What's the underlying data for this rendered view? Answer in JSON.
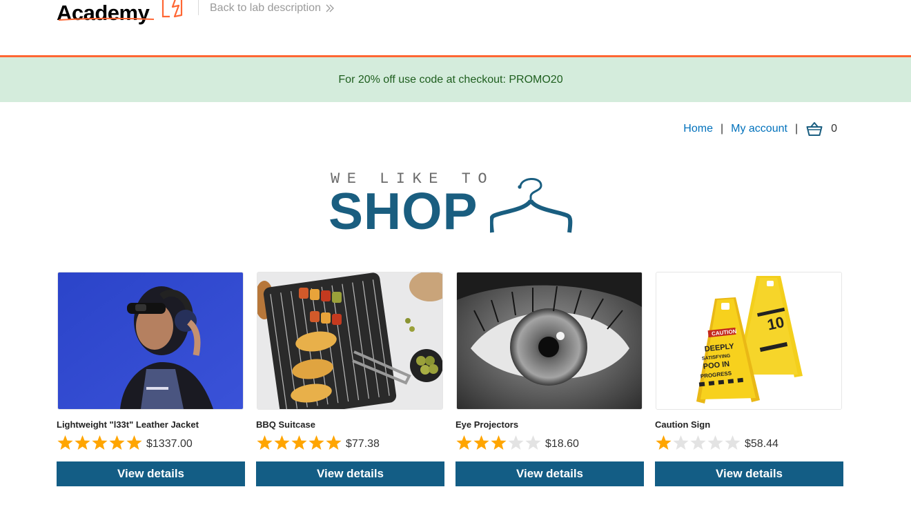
{
  "header": {
    "logo_text": "Academy",
    "back_link_label": "Back to lab description"
  },
  "promo": {
    "text": "For 20% off use code at checkout: PROMO20"
  },
  "nav": {
    "home_label": "Home",
    "separator": "|",
    "account_label": "My account",
    "cart_count": "0"
  },
  "banner": {
    "tagline": "WE LIKE TO",
    "title": "SHOP"
  },
  "products": [
    {
      "name": "Lightweight \"l33t\" Leather Jacket",
      "rating": 5,
      "price": "$1337.00",
      "button_label": "View details"
    },
    {
      "name": "BBQ Suitcase",
      "rating": 5,
      "price": "$77.38",
      "button_label": "View details"
    },
    {
      "name": "Eye Projectors",
      "rating": 3,
      "price": "$18.60",
      "button_label": "View details"
    },
    {
      "name": "Caution Sign",
      "rating": 1,
      "price": "$58.44",
      "button_label": "View details"
    }
  ],
  "colors": {
    "accent_orange": "#ff6633",
    "promo_bg": "#d4ecdc",
    "link_blue": "#0071bc",
    "button_blue": "#135d85",
    "star_filled": "#ffa500",
    "star_empty": "#e3e3e3"
  }
}
